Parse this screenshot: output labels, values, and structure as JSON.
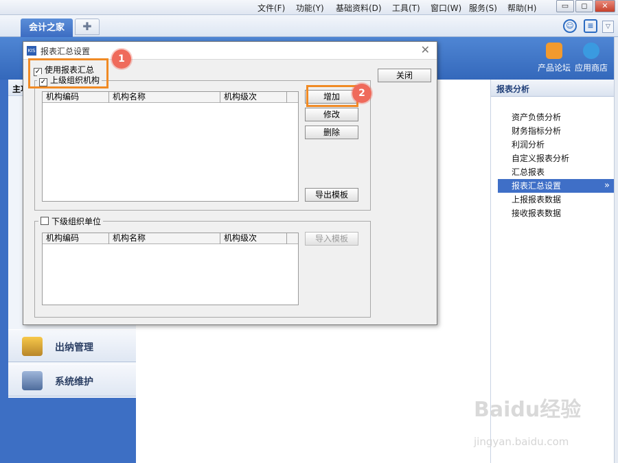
{
  "menubar": {
    "items": [
      "文件(F)",
      "功能(Y)",
      "基础资料(D)",
      "工具(T)",
      "窗口(W)",
      "服务(S)",
      "帮助(H)"
    ],
    "minimize": "▭",
    "restore": "◻",
    "close": "✕"
  },
  "tabs": {
    "active": "会计之家",
    "add": "✚"
  },
  "header_links": [
    {
      "label": "产品论坛",
      "color": "#f29a2e"
    },
    {
      "label": "应用商店",
      "color": "#3a9ae0"
    }
  ],
  "left_nav": {
    "head": "主功",
    "items": [
      "出纳管理",
      "系统维护"
    ]
  },
  "right_panel": {
    "title": "报表分析",
    "items": [
      "资产负债分析",
      "财务指标分析",
      "利润分析",
      "自定义报表分析",
      "汇总报表",
      "报表汇总设置",
      "上报报表数据",
      "接收报表数据"
    ],
    "selected_index": 5,
    "selected_arrow": "»"
  },
  "dialog": {
    "logo": "KIS",
    "title": "报表汇总设置",
    "close_glyph": "✕",
    "use_summary": {
      "label": "使用报表汇总",
      "checked": true
    },
    "upper_org": {
      "label": "上级组织机构",
      "checked": true
    },
    "upper_columns": [
      "机构编码",
      "机构名称",
      "机构级次"
    ],
    "buttons": {
      "add": "增加",
      "edit": "修改",
      "delete": "删除",
      "export_template": "导出模板",
      "close": "关闭",
      "import_template": "导入模板"
    },
    "lower_org": {
      "label": "下级组织单位",
      "checked": false
    },
    "lower_columns": [
      "机构编码",
      "机构名称",
      "机构级次"
    ]
  },
  "annotations": {
    "badge1": "1",
    "badge2": "2"
  },
  "watermark": {
    "line1": "Baidu经验",
    "line2": "jingyan.baidu.com"
  }
}
